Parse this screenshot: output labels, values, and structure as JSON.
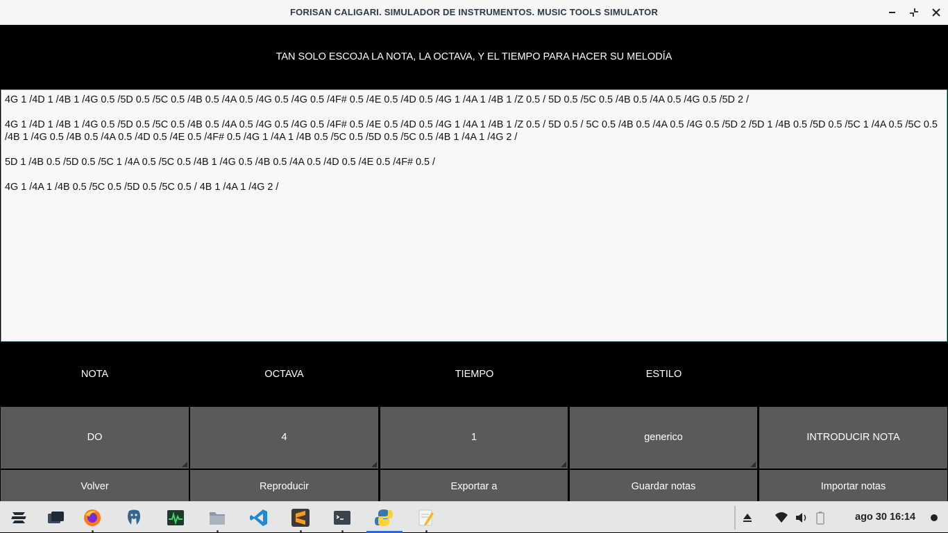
{
  "window": {
    "title": "FORISAN CALIGARI. SIMULADOR DE INSTRUMENTOS. MUSIC TOOLS SIMULATOR",
    "minimize_glyph": "–",
    "maximize_glyph": "⤡",
    "close_glyph": "✕"
  },
  "header": {
    "instruction": "TAN SOLO ESCOJA LA NOTA, LA OCTAVA, Y EL TIEMPO PARA HACER SU MELODÍA"
  },
  "notes": {
    "lines": [
      "4G 1 /4D 1 /4B 1 /4G 0.5 /5D 0.5 /5C 0.5 /4B 0.5 /4A 0.5 /4G 0.5 /4G 0.5 /4F# 0.5 /4E 0.5 /4D 0.5 /4G 1 /4A 1 /4B 1 /Z 0.5 / 5D 0.5 /5C 0.5 /4B 0.5 /4A 0.5 /4G 0.5 /5D 2 /",
      "4G 1 /4D 1 /4B 1 /4G 0.5 /5D 0.5 /5C 0.5 /4B 0.5 /4A 0.5 /4G 0.5 /4G 0.5 /4F# 0.5 /4E 0.5 /4D 0.5 /4G 1 /4A 1 /4B 1 /Z 0.5 / 5D 0.5 / 5C 0.5 /4B 0.5 /4A 0.5 /4G 0.5 /5D 2 /5D 1 /4B 0.5 /5D 0.5 /5C 1 /4A 0.5 /5C 0.5 /4B 1 /4G 0.5 /4B 0.5 /4A 0.5 /4D 0.5 /4E 0.5 /4F# 0.5 /4G 1 /4A 1 /4B 0.5 /5C 0.5 /5D 0.5 /5C 0.5 /4B 1 /4A 1 /4G 2 /",
      "5D 1 /4B 0.5 /5D 0.5 /5C 1 /4A 0.5 /5C 0.5 /4B 1 /4G 0.5 /4B 0.5 /4A 0.5 /4D 0.5 /4E 0.5 /4F# 0.5 /",
      "4G 1 /4A 1 /4B 0.5 /5C 0.5 /5D 0.5 /5C 0.5 / 4B 1 /4A 1 /4G 2 /"
    ]
  },
  "labels": {
    "nota": "NOTA",
    "octava": "OCTAVA",
    "tiempo": "TIEMPO",
    "estilo": "ESTILO"
  },
  "controls": {
    "nota_value": "DO",
    "octava_value": "4",
    "tiempo_value": "1",
    "estilo_value": "generico",
    "introducir_label": "INTRODUCIR NOTA"
  },
  "buttons": {
    "volver": "Volver",
    "reproducir": "Reproducir",
    "exportar": "Exportar a",
    "guardar": "Guardar notas",
    "importar": "Importar notas"
  },
  "taskbar": {
    "apps": [
      "zorin-menu-icon",
      "workspaces-icon",
      "firefox-icon",
      "postgres-icon",
      "system-monitor-icon",
      "files-icon",
      "vscode-icon",
      "sublime-text-icon",
      "terminal-icon",
      "python-icon",
      "text-editor-icon"
    ],
    "clock": "ago 30   16:14"
  },
  "colors": {
    "button_bg": "#5a5a5a",
    "text_area_bg": "#f8f8f8",
    "accent": "#2a6ad8"
  }
}
